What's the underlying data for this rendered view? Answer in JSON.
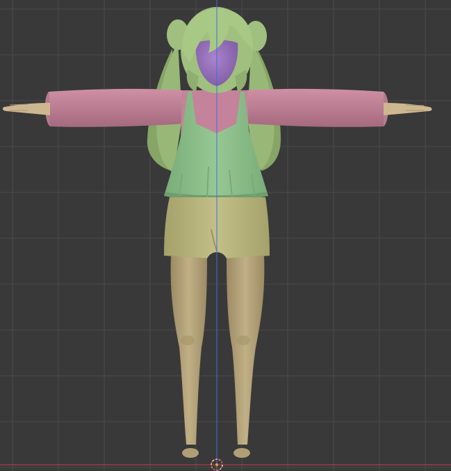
{
  "viewport": {
    "background_color": "#393939",
    "grid_color": "#4a4a4a",
    "axis_vertical_color": "#3f6fd8",
    "axis_horizontal_color": "#c8404f",
    "origin_marker_color": "#e0a03a"
  },
  "model": {
    "description_colors": {
      "hair": "#9fc07e",
      "hair_shadow": "#7e9c60",
      "face": "#9a6fc0",
      "sleeves": "#c4839a",
      "sleeve_shadow": "#a66a80",
      "top": "#8fc08c",
      "top_shadow": "#6f9f6e",
      "shorts": "#b9b77e",
      "shorts_shadow": "#98965e",
      "skin": "#b7a57c",
      "skin_shadow": "#978660",
      "hands": "#cdb790"
    }
  }
}
